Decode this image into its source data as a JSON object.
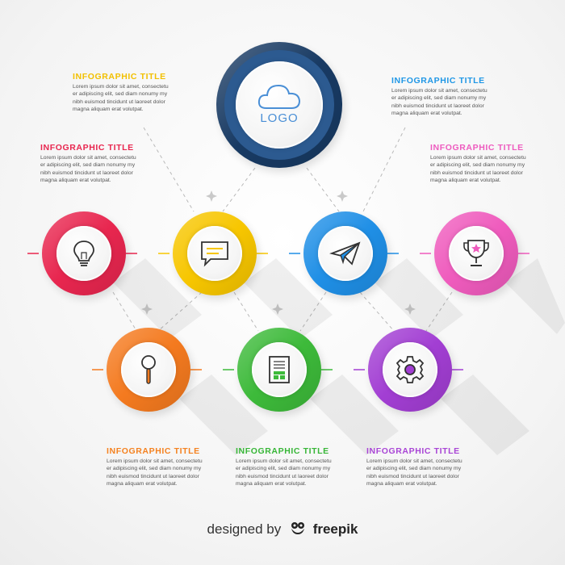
{
  "center": {
    "logo_label": "LOGO",
    "icon": "cloud-icon"
  },
  "text_blocks": [
    {
      "id": "top-left",
      "title": "INFOGRAPHIC TITLE",
      "color": "#f2c000",
      "lines": [
        "Lorem ipsum dolor sit amet, consectetu",
        "er adipiscing elit, sed diam nonumy my",
        "nibh euismod tincidunt ut laoreet dolor",
        "magna aliquam erat volutpat."
      ]
    },
    {
      "id": "top-right",
      "title": "INFOGRAPHIC TITLE",
      "color": "#1f97e6",
      "lines": [
        "Lorem ipsum dolor sit amet, consectetu",
        "er adipiscing elit, sed diam nonumy my",
        "nibh euismod tincidunt ut laoreet dolor",
        "magna aliquam erat volutpat."
      ]
    },
    {
      "id": "mid-left",
      "title": "INFOGRAPHIC TITLE",
      "color": "#e8264f",
      "lines": [
        "Lorem ipsum dolor sit amet, consectetu",
        "er adipiscing elit, sed diam nonumy my",
        "nibh euismod tincidunt ut laoreet dolor",
        "magna aliquam erat volutpat."
      ]
    },
    {
      "id": "mid-right",
      "title": "INFOGRAPHIC TITLE",
      "color": "#ee5bbf",
      "lines": [
        "Lorem ipsum dolor sit amet, consectetu",
        "er adipiscing elit, sed diam nonumy my",
        "nibh euismod tincidunt ut laoreet dolor",
        "magna aliquam erat volutpat."
      ]
    },
    {
      "id": "bottom-left",
      "title": "INFOGRAPHIC TITLE",
      "color": "#f58220",
      "lines": [
        "Lorem ipsum dolor sit amet, consectetu",
        "er adipiscing elit, sed diam nonumy my",
        "nibh euismod tincidunt ut laoreet dolor",
        "magna aliquam erat volutpat."
      ]
    },
    {
      "id": "bottom-center",
      "title": "INFOGRAPHIC TITLE",
      "color": "#37b637",
      "lines": [
        "Lorem ipsum dolor sit amet, consectetu",
        "er adipiscing elit, sed diam nonumy my",
        "nibh euismod tincidunt ut laoreet dolor",
        "magna aliquam erat volutpat."
      ]
    },
    {
      "id": "bottom-right",
      "title": "INFOGRAPHIC TITLE",
      "color": "#a945d6",
      "lines": [
        "Lorem ipsum dolor sit amet, consectetu",
        "er adipiscing elit, sed diam nonumy my",
        "nibh euismod tincidunt ut laoreet dolor",
        "magna aliquam erat volutpat."
      ]
    }
  ],
  "nodes": [
    {
      "id": "red",
      "icon": "lightbulb-icon",
      "color": "#e8264f"
    },
    {
      "id": "yellow",
      "icon": "chat-bubble-icon",
      "color": "#f7c600"
    },
    {
      "id": "blue",
      "icon": "paper-plane-icon",
      "color": "#1f8fe6"
    },
    {
      "id": "pink",
      "icon": "trophy-icon",
      "color": "#ef5bbd"
    },
    {
      "id": "orange",
      "icon": "magnifier-icon",
      "color": "#f47a1f"
    },
    {
      "id": "green",
      "icon": "document-icon",
      "color": "#3dba3a"
    },
    {
      "id": "purple",
      "icon": "gear-icon",
      "color": "#a23ed3"
    }
  ],
  "credit": {
    "prefix": "designed by",
    "brand": "freepik",
    "icon": "freepik-frog-icon"
  }
}
